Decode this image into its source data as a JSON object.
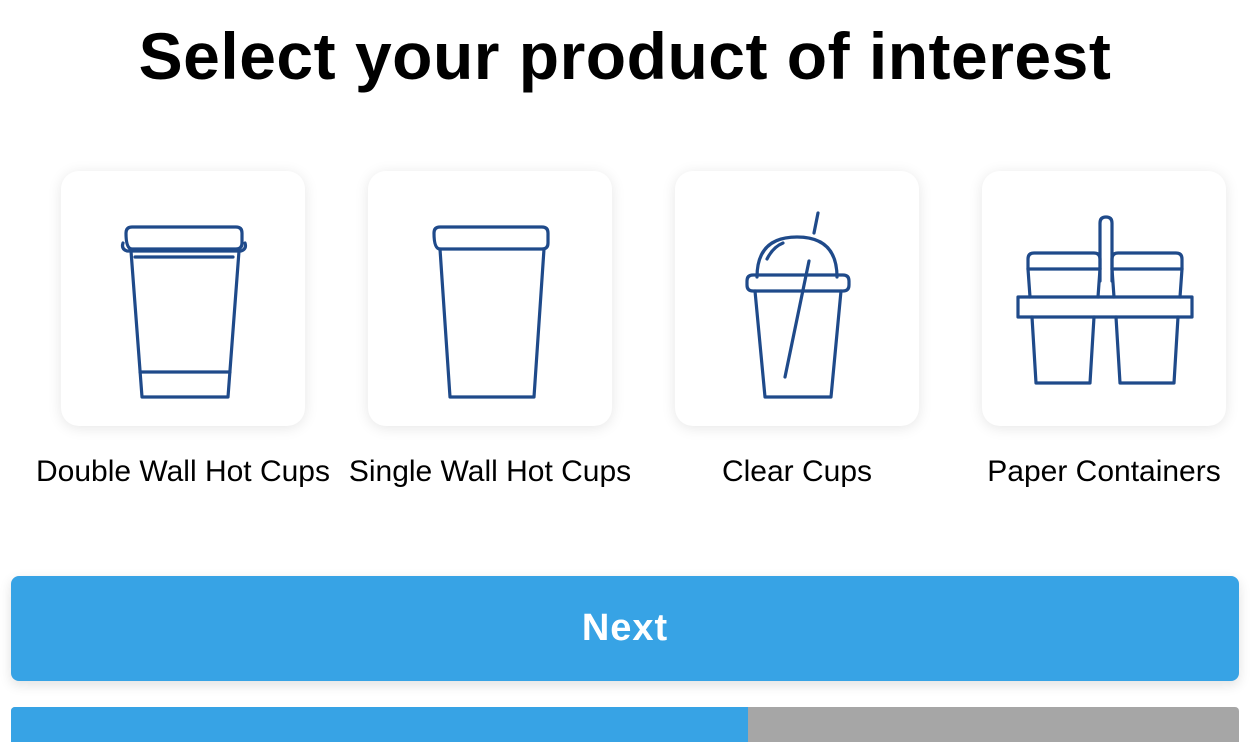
{
  "page": {
    "title": "Select your product of interest"
  },
  "products": [
    {
      "label": "Double Wall Hot Cups",
      "icon": "double-wall-cup-icon"
    },
    {
      "label": "Single Wall Hot Cups",
      "icon": "single-wall-cup-icon"
    },
    {
      "label": "Clear Cups",
      "icon": "clear-cup-icon"
    },
    {
      "label": "Paper Containers",
      "icon": "paper-container-carrier-icon"
    }
  ],
  "next_button": {
    "label": "Next"
  },
  "progress": {
    "fraction": 0.6
  },
  "colors": {
    "accent": "#37a3e5",
    "icon_stroke": "#1f4a8a",
    "progress_track": "#a6a6a6"
  }
}
